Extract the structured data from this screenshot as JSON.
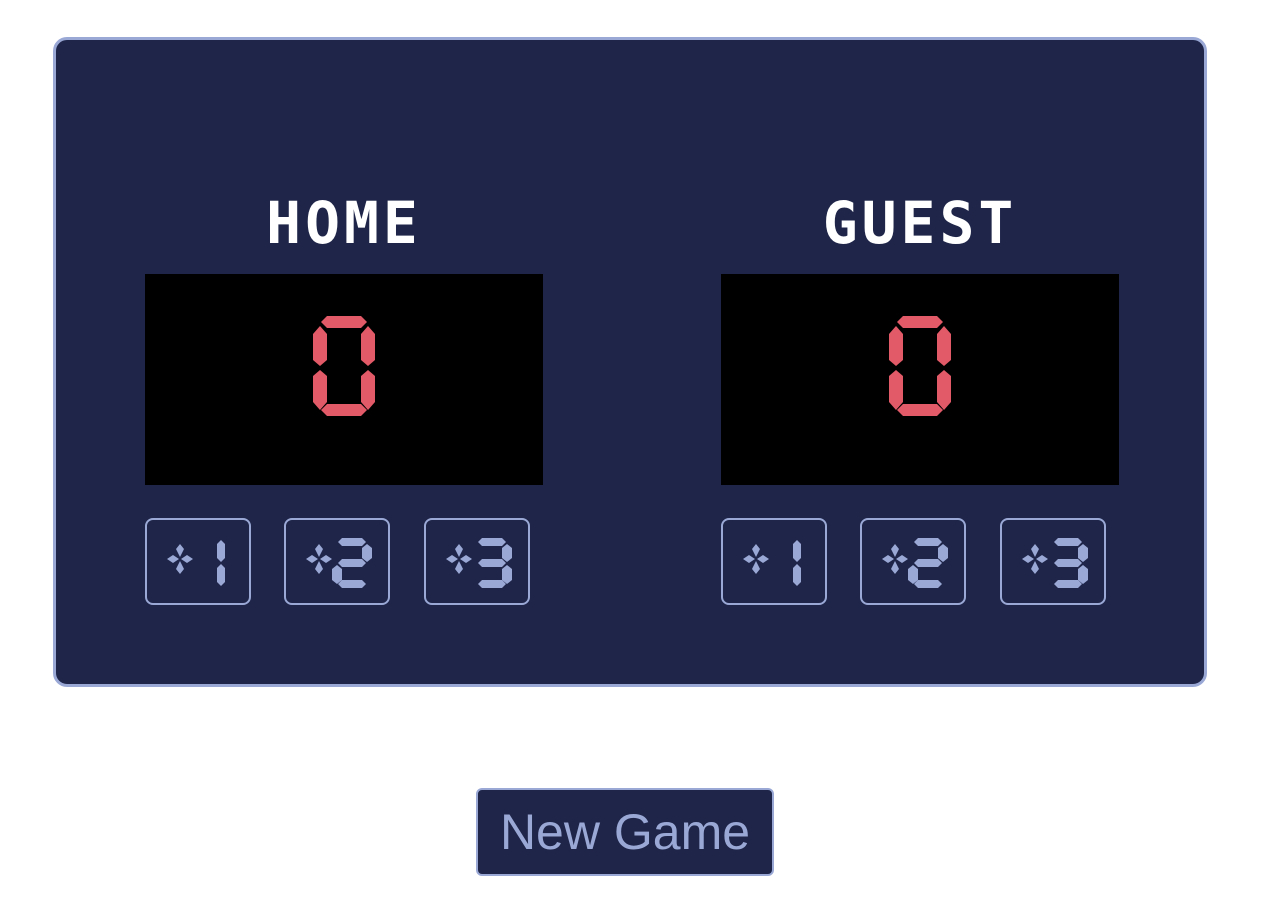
{
  "colors": {
    "board_bg": "#1e2548",
    "border": "#9aa8d6",
    "score_digit": "#e25a67",
    "title": "#ffffff",
    "display_bg": "#000000"
  },
  "home": {
    "title": "HOME",
    "score": "0",
    "buttons": [
      "+1",
      "+2",
      "+3"
    ]
  },
  "guest": {
    "title": "GUEST",
    "score": "0",
    "buttons": [
      "+1",
      "+2",
      "+3"
    ]
  },
  "new_game_label": "New Game"
}
